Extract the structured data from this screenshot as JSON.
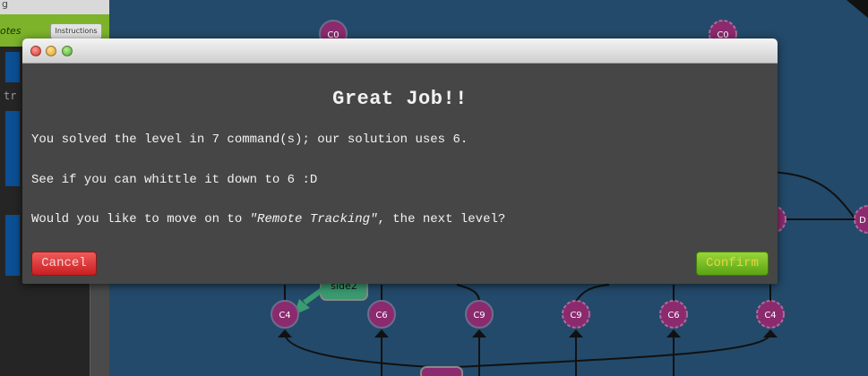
{
  "app": {
    "sidebar_top_text": "g",
    "notes_label": "otes",
    "instructions_button": "Instructions",
    "console_text": "tr"
  },
  "graph": {
    "nodes_top": [
      "C0",
      "C0"
    ],
    "nodes_right": [
      "",
      "D"
    ],
    "nodes_bottom": [
      "C4",
      "C6",
      "C9",
      "C9",
      "C6",
      "C4"
    ],
    "branch_label": "side2"
  },
  "modal": {
    "heading": "Great Job!!",
    "line1": "You solved the level in 7 command(s); our solution uses 6.",
    "line2": "See if you can whittle it down to 6 :D",
    "line3_prefix": "Would you like to move on to ",
    "line3_level": "\"Remote Tracking\"",
    "line3_suffix": ", the next level?",
    "cancel_label": "Cancel",
    "confirm_label": "Confirm"
  },
  "colors": {
    "background": "#234a6a",
    "node_fill": "#8b2a6e",
    "cancel": "#d9302f",
    "confirm": "#6cb81e"
  }
}
